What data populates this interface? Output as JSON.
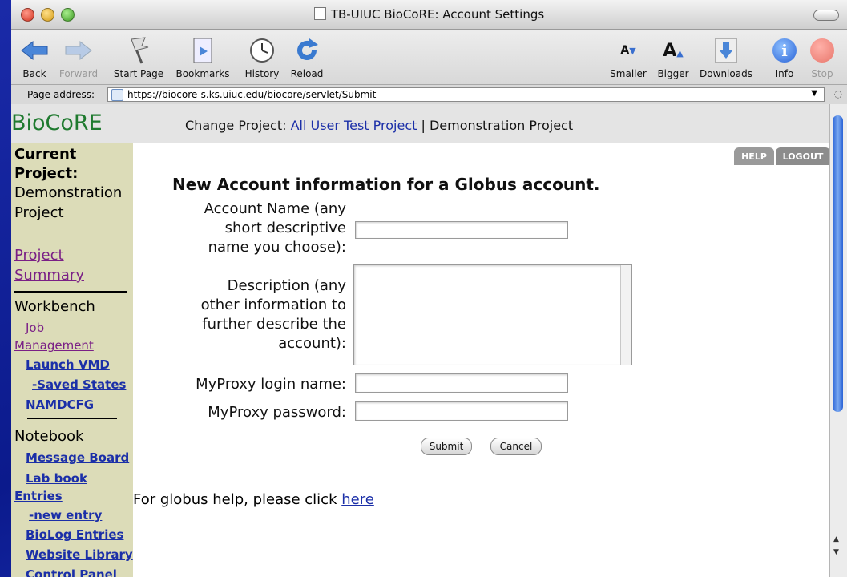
{
  "window": {
    "title": "TB-UIUC BioCoRE: Account Settings"
  },
  "toolbar": {
    "back": "Back",
    "forward": "Forward",
    "start_page": "Start Page",
    "bookmarks": "Bookmarks",
    "history": "History",
    "reload": "Reload",
    "smaller": "Smaller",
    "bigger": "Bigger",
    "downloads": "Downloads",
    "info": "Info",
    "stop": "Stop"
  },
  "address": {
    "label": "Page address:",
    "url": "https://biocore-s.ks.uiuc.edu/biocore/servlet/Submit"
  },
  "header": {
    "logo": "BioCoRE",
    "change_project_label": "Change Project:",
    "project_link": "All User Test Project",
    "separator": "|",
    "current_project_name": "Demonstration Project"
  },
  "sidebar": {
    "current_project_label_1": "Current",
    "current_project_label_2": "Project:",
    "current_project_value_1": "Demonstration",
    "current_project_value_2": "Project",
    "project_summary_1": "Project",
    "project_summary_2": "Summary",
    "workbench_heading": "Workbench",
    "job_management_1": "Job",
    "job_management_2": "Management",
    "launch_vmd": "Launch VMD",
    "saved_states": "-Saved States",
    "namdcfg": "NAMDCFG",
    "notebook_heading": "Notebook",
    "message_board": "Message Board",
    "lab_book_1": "Lab book",
    "lab_book_2": "Entries",
    "new_entry": "-new entry",
    "biolog_entries": "BioLog Entries",
    "website_library": "Website Library",
    "control_panel": "Control Panel"
  },
  "main": {
    "help_button": "HELP",
    "logout_button": "LOGOUT",
    "heading": "New Account information for a Globus account.",
    "account_name_label_1": "Account Name (any",
    "account_name_label_2": "short descriptive",
    "account_name_label_3": "name you choose):",
    "account_name_value": "",
    "description_label_1": "Description (any",
    "description_label_2": "other information to",
    "description_label_3": "further describe the",
    "description_label_4": "account):",
    "description_value": "",
    "myproxy_login_label": "MyProxy login name:",
    "myproxy_login_value": "",
    "myproxy_password_label": "MyProxy password:",
    "myproxy_password_value": "",
    "submit_button": "Submit",
    "cancel_button": "Cancel",
    "help_text": "For globus help, please click",
    "help_link": "here"
  }
}
